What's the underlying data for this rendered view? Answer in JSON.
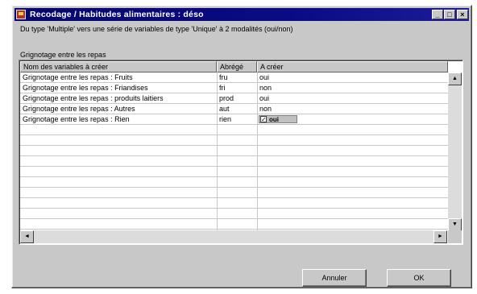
{
  "window": {
    "title": "Recodage / Habitudes alimentaires : déso",
    "minimize": "_",
    "maximize": "□",
    "close": "×"
  },
  "description": "Du type 'Multiple' vers une série de variables de type 'Unique' à 2 modalités (oui/non)",
  "group_label": "Grignotage entre les repas",
  "grid": {
    "headers": [
      "Nom des variables à créer",
      "Abrégé",
      "A créer"
    ],
    "rows": [
      {
        "name": "Grignotage entre les repas : Fruits",
        "abbr": "fru",
        "create": "oui"
      },
      {
        "name": "Grignotage entre les repas : Friandises",
        "abbr": "fri",
        "create": "non"
      },
      {
        "name": "Grignotage entre les repas : produits laitiers",
        "abbr": "prod",
        "create": "oui"
      },
      {
        "name": "Grignotage entre les repas : Autres",
        "abbr": "aut",
        "create": "non"
      },
      {
        "name": "Grignotage entre les repas : Rien",
        "abbr": "rien",
        "create": "oui",
        "editing": true
      }
    ],
    "check_mark": "✓",
    "scroll_up": "▲",
    "scroll_down": "▼",
    "scroll_left": "◄",
    "scroll_right": "►"
  },
  "buttons": {
    "cancel": "Annuler",
    "ok": "OK"
  }
}
